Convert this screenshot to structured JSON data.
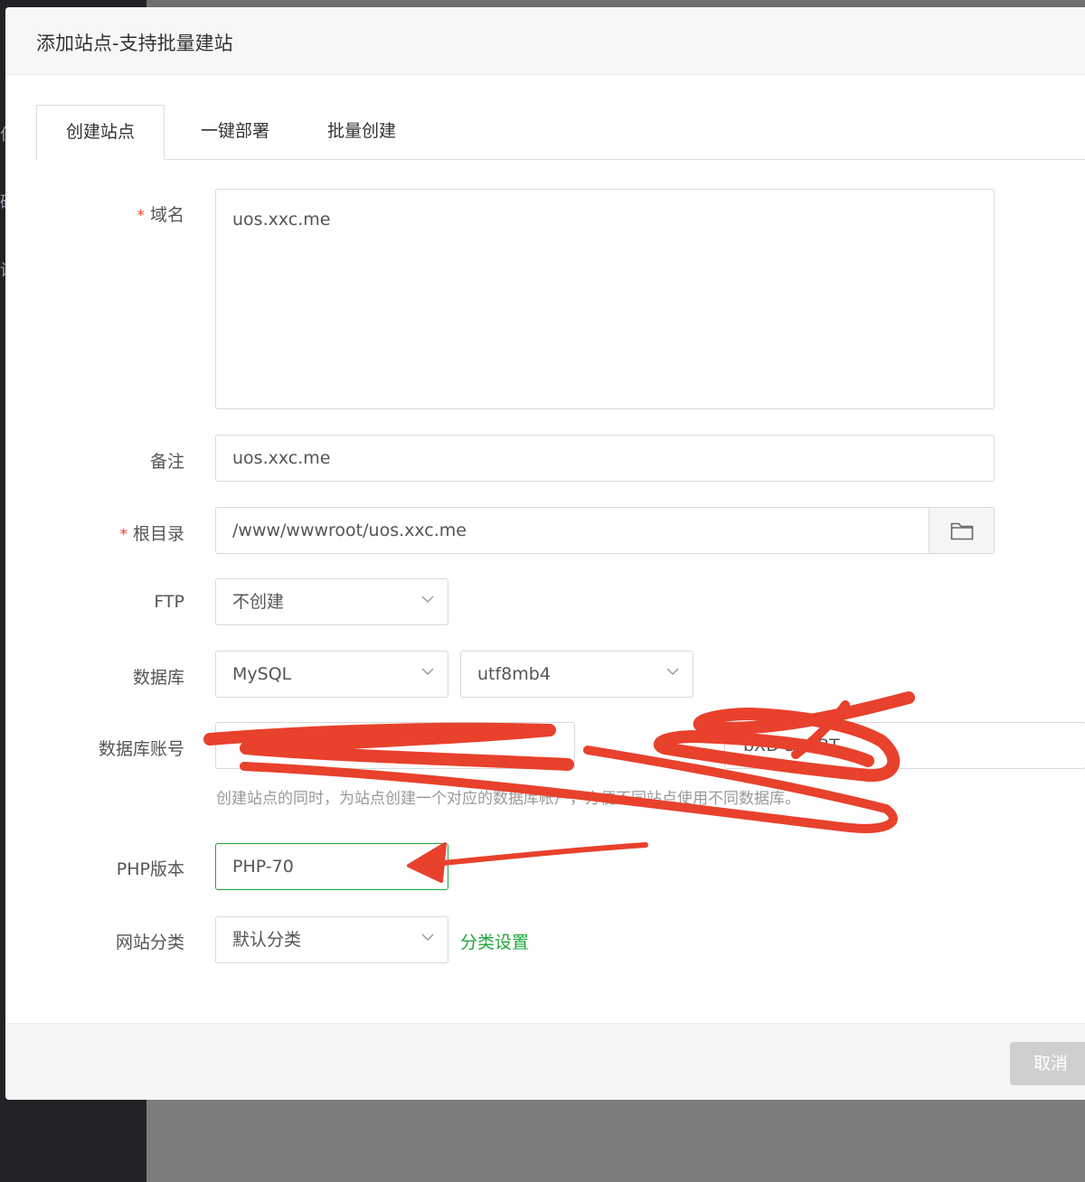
{
  "dialog": {
    "title": "添加站点-支持批量建站",
    "tabs": [
      {
        "label": "创建站点",
        "active": true
      },
      {
        "label": "一键部署",
        "active": false
      },
      {
        "label": "批量创建",
        "active": false
      }
    ],
    "form": {
      "domain": {
        "label": "域名",
        "required": true,
        "value": "uos.xxc.me"
      },
      "remark": {
        "label": "备注",
        "value": "uos.xxc.me"
      },
      "root": {
        "label": "根目录",
        "required": true,
        "value": "/www/wwwroot/uos.xxc.me",
        "button_icon": "folder-icon"
      },
      "ftp": {
        "label": "FTP",
        "value": "不创建"
      },
      "database": {
        "label": "数据库",
        "type_value": "MySQL",
        "charset_value": "utf8mb4"
      },
      "db_account": {
        "label": "数据库账号",
        "password_visible_fragment": "bXD 359BT"
      },
      "db_hint": "创建站点的同时，为站点创建一个对应的数据库帐户，方便不同站点使用不同数据库。",
      "php": {
        "label": "PHP版本",
        "value": "PHP-70"
      },
      "category": {
        "label": "网站分类",
        "value": "默认分类",
        "link": "分类设置"
      }
    },
    "footer": {
      "cancel_label": "取消"
    }
  },
  "background": {
    "ghost_glyphs": [
      "住",
      "础",
      "设"
    ]
  },
  "colors": {
    "accent_green": "#20a53a",
    "annotation_red": "#e8412c"
  }
}
